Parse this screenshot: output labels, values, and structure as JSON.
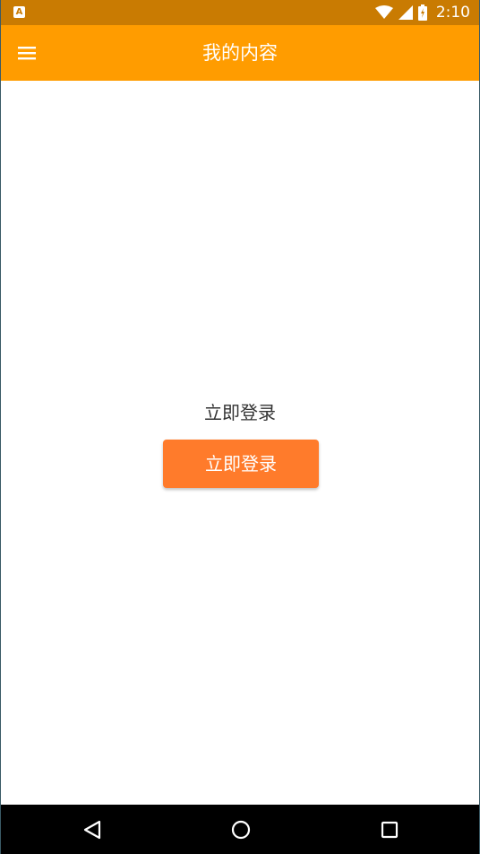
{
  "status_bar": {
    "notification_icon": "A",
    "time": "2:10",
    "icons": [
      "wifi-icon",
      "signal-icon",
      "battery-icon"
    ]
  },
  "app_bar": {
    "title": "我的内容",
    "menu_icon": "menu-icon",
    "background_color": "#ff9c00"
  },
  "main": {
    "login_prompt": "立即登录",
    "login_button_label": "立即登录",
    "button_color": "#ff7b2b"
  },
  "nav_bar": {
    "buttons": [
      "back-icon",
      "home-icon",
      "recents-icon"
    ]
  }
}
